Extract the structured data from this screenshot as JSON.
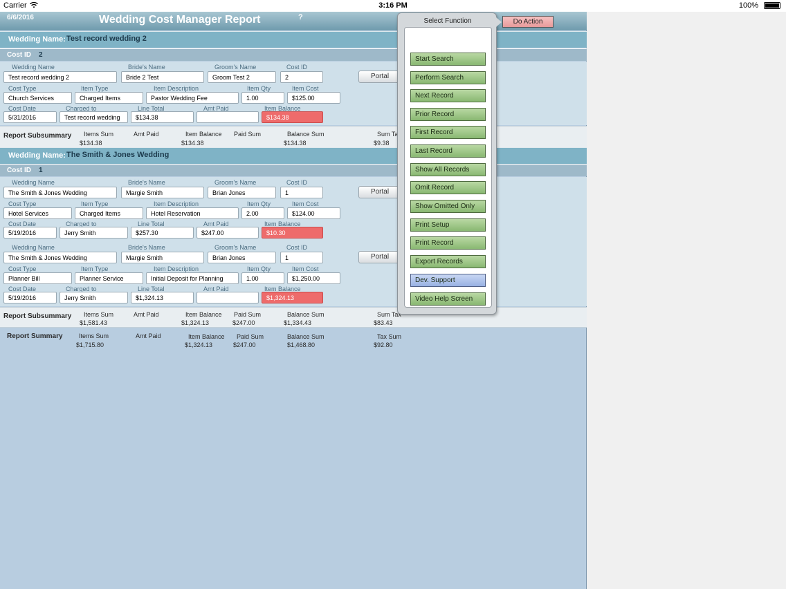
{
  "status_bar": {
    "carrier": "Carrier",
    "time": "3:16 PM",
    "battery": "100%"
  },
  "header": {
    "date": "6/6/2016",
    "title": "Wedding Cost Manager Report",
    "help": "?"
  },
  "labels": {
    "wedding_name_bar": "Wedding Name:",
    "cost_id": "Cost ID",
    "wedding_name": "Wedding Name",
    "brides_name": "Bride's Name",
    "grooms_name": "Groom's Name",
    "cost_type": "Cost Type",
    "item_type": "Item Type",
    "item_description": "Item Description",
    "item_qty": "Item Qty",
    "item_cost": "Item Cost",
    "cost_date": "Cost Date",
    "charged_to": "Charged to",
    "line_total": "Line Total",
    "amt_paid": "Amt Paid",
    "item_balance": "Item Balance",
    "portal": "Portal",
    "report_subsummary": "Report Subsummary",
    "report_summary": "Report Summary",
    "items_sum": "Items Sum",
    "paid_sum": "Paid Sum",
    "balance_sum": "Balance Sum",
    "sum_tax": "Sum Tax",
    "tax_sum": "Tax Sum"
  },
  "groups": [
    {
      "wedding_name": "Test record wedding 2",
      "cost_id": "2",
      "records": [
        {
          "wedding_name": "Test record wedding 2",
          "brides_name": "Bride 2 Test",
          "grooms_name": "Groom Test 2",
          "cost_id": "2",
          "cost_type": "Church Services",
          "item_type": "Charged Items",
          "item_description": "Pastor Wedding Fee",
          "item_qty": "1.00",
          "item_cost": "$125.00",
          "cost_date": "5/31/2016",
          "charged_to": "Test record wedding",
          "line_total": "$134.38",
          "amt_paid": "",
          "item_balance": "$134.38"
        }
      ],
      "subsummary": {
        "items_sum": "$134.38",
        "amt_paid": "",
        "item_balance": "$134.38",
        "paid_sum": "",
        "balance_sum": "$134.38",
        "sum_tax": "$9.38"
      }
    },
    {
      "wedding_name": "The Smith & Jones Wedding",
      "cost_id": "1",
      "records": [
        {
          "wedding_name": "The Smith & Jones Wedding",
          "brides_name": "Margie Smith",
          "grooms_name": "Brian Jones",
          "cost_id": "1",
          "cost_type": "Hotel Services",
          "item_type": "Charged Items",
          "item_description": "Hotel Reservation",
          "item_qty": "2.00",
          "item_cost": "$124.00",
          "cost_date": "5/19/2016",
          "charged_to": "Jerry Smith",
          "line_total": "$257.30",
          "amt_paid": "$247.00",
          "item_balance": "$10.30"
        },
        {
          "wedding_name": "The Smith & Jones Wedding",
          "brides_name": "Margie Smith",
          "grooms_name": "Brian Jones",
          "cost_id": "1",
          "cost_type": "Planner Bill",
          "item_type": "Planner Service",
          "item_description": "Initial Deposit for Planning",
          "item_qty": "1.00",
          "item_cost": "$1,250.00",
          "cost_date": "5/19/2016",
          "charged_to": "Jerry Smith",
          "line_total": "$1,324.13",
          "amt_paid": "",
          "item_balance": "$1,324.13"
        }
      ],
      "subsummary": {
        "items_sum": "$1,581.43",
        "amt_paid": "",
        "item_balance": "$1,324.13",
        "paid_sum": "$247.00",
        "balance_sum": "$1,334.43",
        "sum_tax": "$83.43"
      }
    }
  ],
  "summary": {
    "items_sum": "$1,715.80",
    "amt_paid": "",
    "item_balance": "$1,324.13",
    "paid_sum": "$247.00",
    "balance_sum": "$1,468.80",
    "tax_sum": "$92.80"
  },
  "popup": {
    "title": "Select Function",
    "buttons": [
      "Start Search",
      "Perform Search",
      "Next Record",
      "Prior Record",
      "First Record",
      "Last Record",
      "Show All Records",
      "Omit Record",
      "Show Omitted Only",
      "Print Setup",
      "Print Record",
      "Export Records",
      "Dev. Support",
      "Video Help Screen"
    ]
  },
  "do_action": "Do Action",
  "colors": {
    "header": "#6f9bad",
    "wedding_bar": "#7fb3c6",
    "balance_red": "#ee6b6b",
    "func_button": "#89b872",
    "dev_button": "#98b1e3"
  }
}
